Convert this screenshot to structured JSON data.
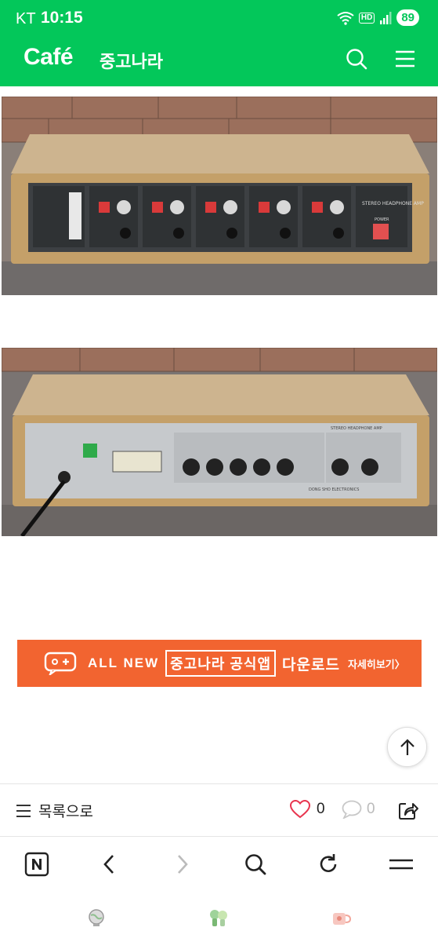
{
  "status_bar": {
    "carrier": "KT",
    "time": "10:15",
    "battery": "89",
    "hd": "HD"
  },
  "header": {
    "brand": "Café",
    "cafe_name": "중고나라"
  },
  "banner": {
    "all_new": "ALL NEW",
    "official": "중고나라 공식앱",
    "download": "다운로드",
    "details": "자세히보기〉",
    "color": "#f26430"
  },
  "article_bar": {
    "list_label": "목록으로",
    "like_count": "0",
    "comment_count": "0"
  },
  "colors": {
    "brand_green": "#03c75a",
    "like_red": "#e8344e"
  },
  "photos": [
    {
      "subject": "stereo-headphone-amp-front",
      "panel_text": "STEREO HEADPHONE AMP",
      "button_label": "POWER"
    },
    {
      "subject": "stereo-headphone-amp-rear",
      "panel_text": "STEREO HEADPHONE AMP",
      "maker": "DONG SHO ELECTRONICS"
    }
  ]
}
